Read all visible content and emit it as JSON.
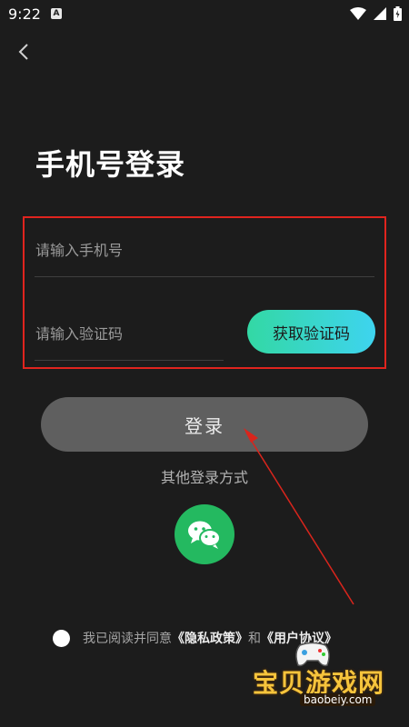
{
  "status_bar": {
    "time": "9:22",
    "notification_icon": "A"
  },
  "page": {
    "title": "手机号登录"
  },
  "form": {
    "phone_placeholder": "请输入手机号",
    "code_placeholder": "请输入验证码",
    "get_code_label": "获取验证码"
  },
  "actions": {
    "login_label": "登录",
    "other_methods": "其他登录方式"
  },
  "agreement": {
    "prefix": "我已阅读并同意",
    "privacy": "《隐私政策》",
    "and": "和",
    "terms": "《用户协议》"
  },
  "watermark": {
    "name": "宝贝游戏网",
    "url": "baobeiy.com"
  },
  "colors": {
    "background": "#1c1c1c",
    "accent_start": "#33d8a4",
    "accent_end": "#3ed4ef",
    "wechat": "#24b960",
    "highlight_box": "#e0241e"
  }
}
